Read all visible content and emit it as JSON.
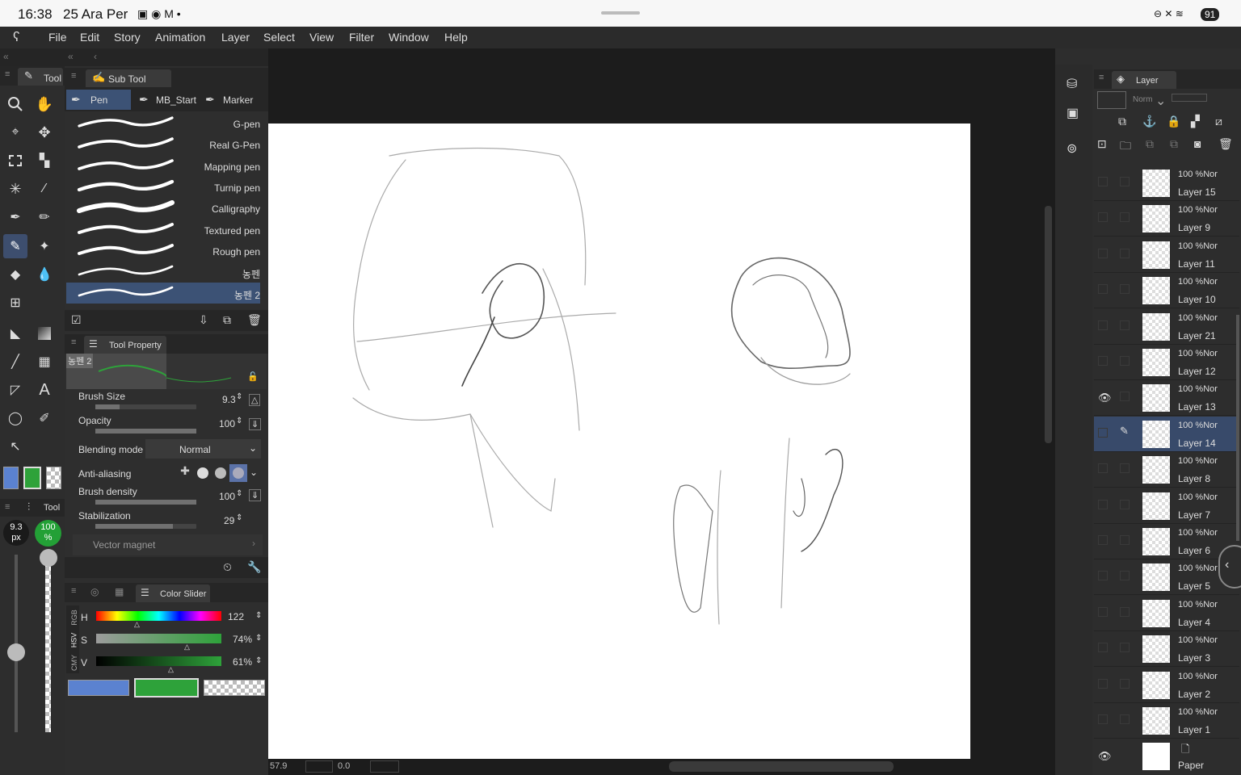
{
  "status": {
    "time": "16:38",
    "date": "25 Ara Per",
    "battery": "91"
  },
  "menu": [
    "File",
    "Edit",
    "Story",
    "Animation",
    "Layer",
    "Select",
    "View",
    "Filter",
    "Window",
    "Help"
  ],
  "tool_panel": {
    "title": "Tool"
  },
  "subtool_panel": {
    "title": "Sub Tool",
    "tabs": [
      "Pen",
      "MB_Start",
      "Marker"
    ],
    "brushes": [
      "G-pen",
      "Real G-Pen",
      "Mapping pen",
      "Turnip pen",
      "Calligraphy",
      "Textured pen",
      "Rough pen",
      "농펜",
      "농펜 2"
    ]
  },
  "tool_property": {
    "title": "Tool Property",
    "preview_label": "농펜 2",
    "brush_size_label": "Brush Size",
    "brush_size": "9.3",
    "opacity_label": "Opacity",
    "opacity": "100",
    "blending_label": "Blending mode",
    "blending": "Normal",
    "antialias_label": "Anti-aliasing",
    "density_label": "Brush density",
    "density": "100",
    "stabilization_label": "Stabilization",
    "stabilization": "29",
    "vector_magnet": "Vector magnet"
  },
  "left_indicators": {
    "size": "9.3",
    "size_unit": "px",
    "opacity": "100",
    "opacity_unit": "%",
    "tool_label": "Tool"
  },
  "color_slider": {
    "title": "Color Slider",
    "modes": [
      "RGB",
      "HSV",
      "CMY"
    ],
    "h_label": "H",
    "h": "122",
    "s_label": "S",
    "s": "74%",
    "v_label": "V",
    "v": "61%",
    "main_color": "#5b82d0",
    "sub_color": "#2ea23a"
  },
  "layer_panel": {
    "title": "Layer",
    "blend_short": "Norm",
    "layers": [
      {
        "opacity": "100 %Nor",
        "name": "Layer 15"
      },
      {
        "opacity": "100 %Nor",
        "name": "Layer 9"
      },
      {
        "opacity": "100 %Nor",
        "name": "Layer 11"
      },
      {
        "opacity": "100 %Nor",
        "name": "Layer 10"
      },
      {
        "opacity": "100 %Nor",
        "name": "Layer 21"
      },
      {
        "opacity": "100 %Nor",
        "name": "Layer 12"
      },
      {
        "opacity": "100 %Nor",
        "name": "Layer 13"
      },
      {
        "opacity": "100 %Nor",
        "name": "Layer 14"
      },
      {
        "opacity": "100 %Nor",
        "name": "Layer 8"
      },
      {
        "opacity": "100 %Nor",
        "name": "Layer 7"
      },
      {
        "opacity": "100 %Nor",
        "name": "Layer 6"
      },
      {
        "opacity": "100 %Nor",
        "name": "Layer 5"
      },
      {
        "opacity": "100 %Nor",
        "name": "Layer 4"
      },
      {
        "opacity": "100 %Nor",
        "name": "Layer 3"
      },
      {
        "opacity": "100 %Nor",
        "name": "Layer 2"
      },
      {
        "opacity": "100 %Nor",
        "name": "Layer 1"
      }
    ],
    "paper_name": "Paper"
  },
  "canvas_footer": {
    "zoom": "57.9",
    "angle": "0.0"
  }
}
